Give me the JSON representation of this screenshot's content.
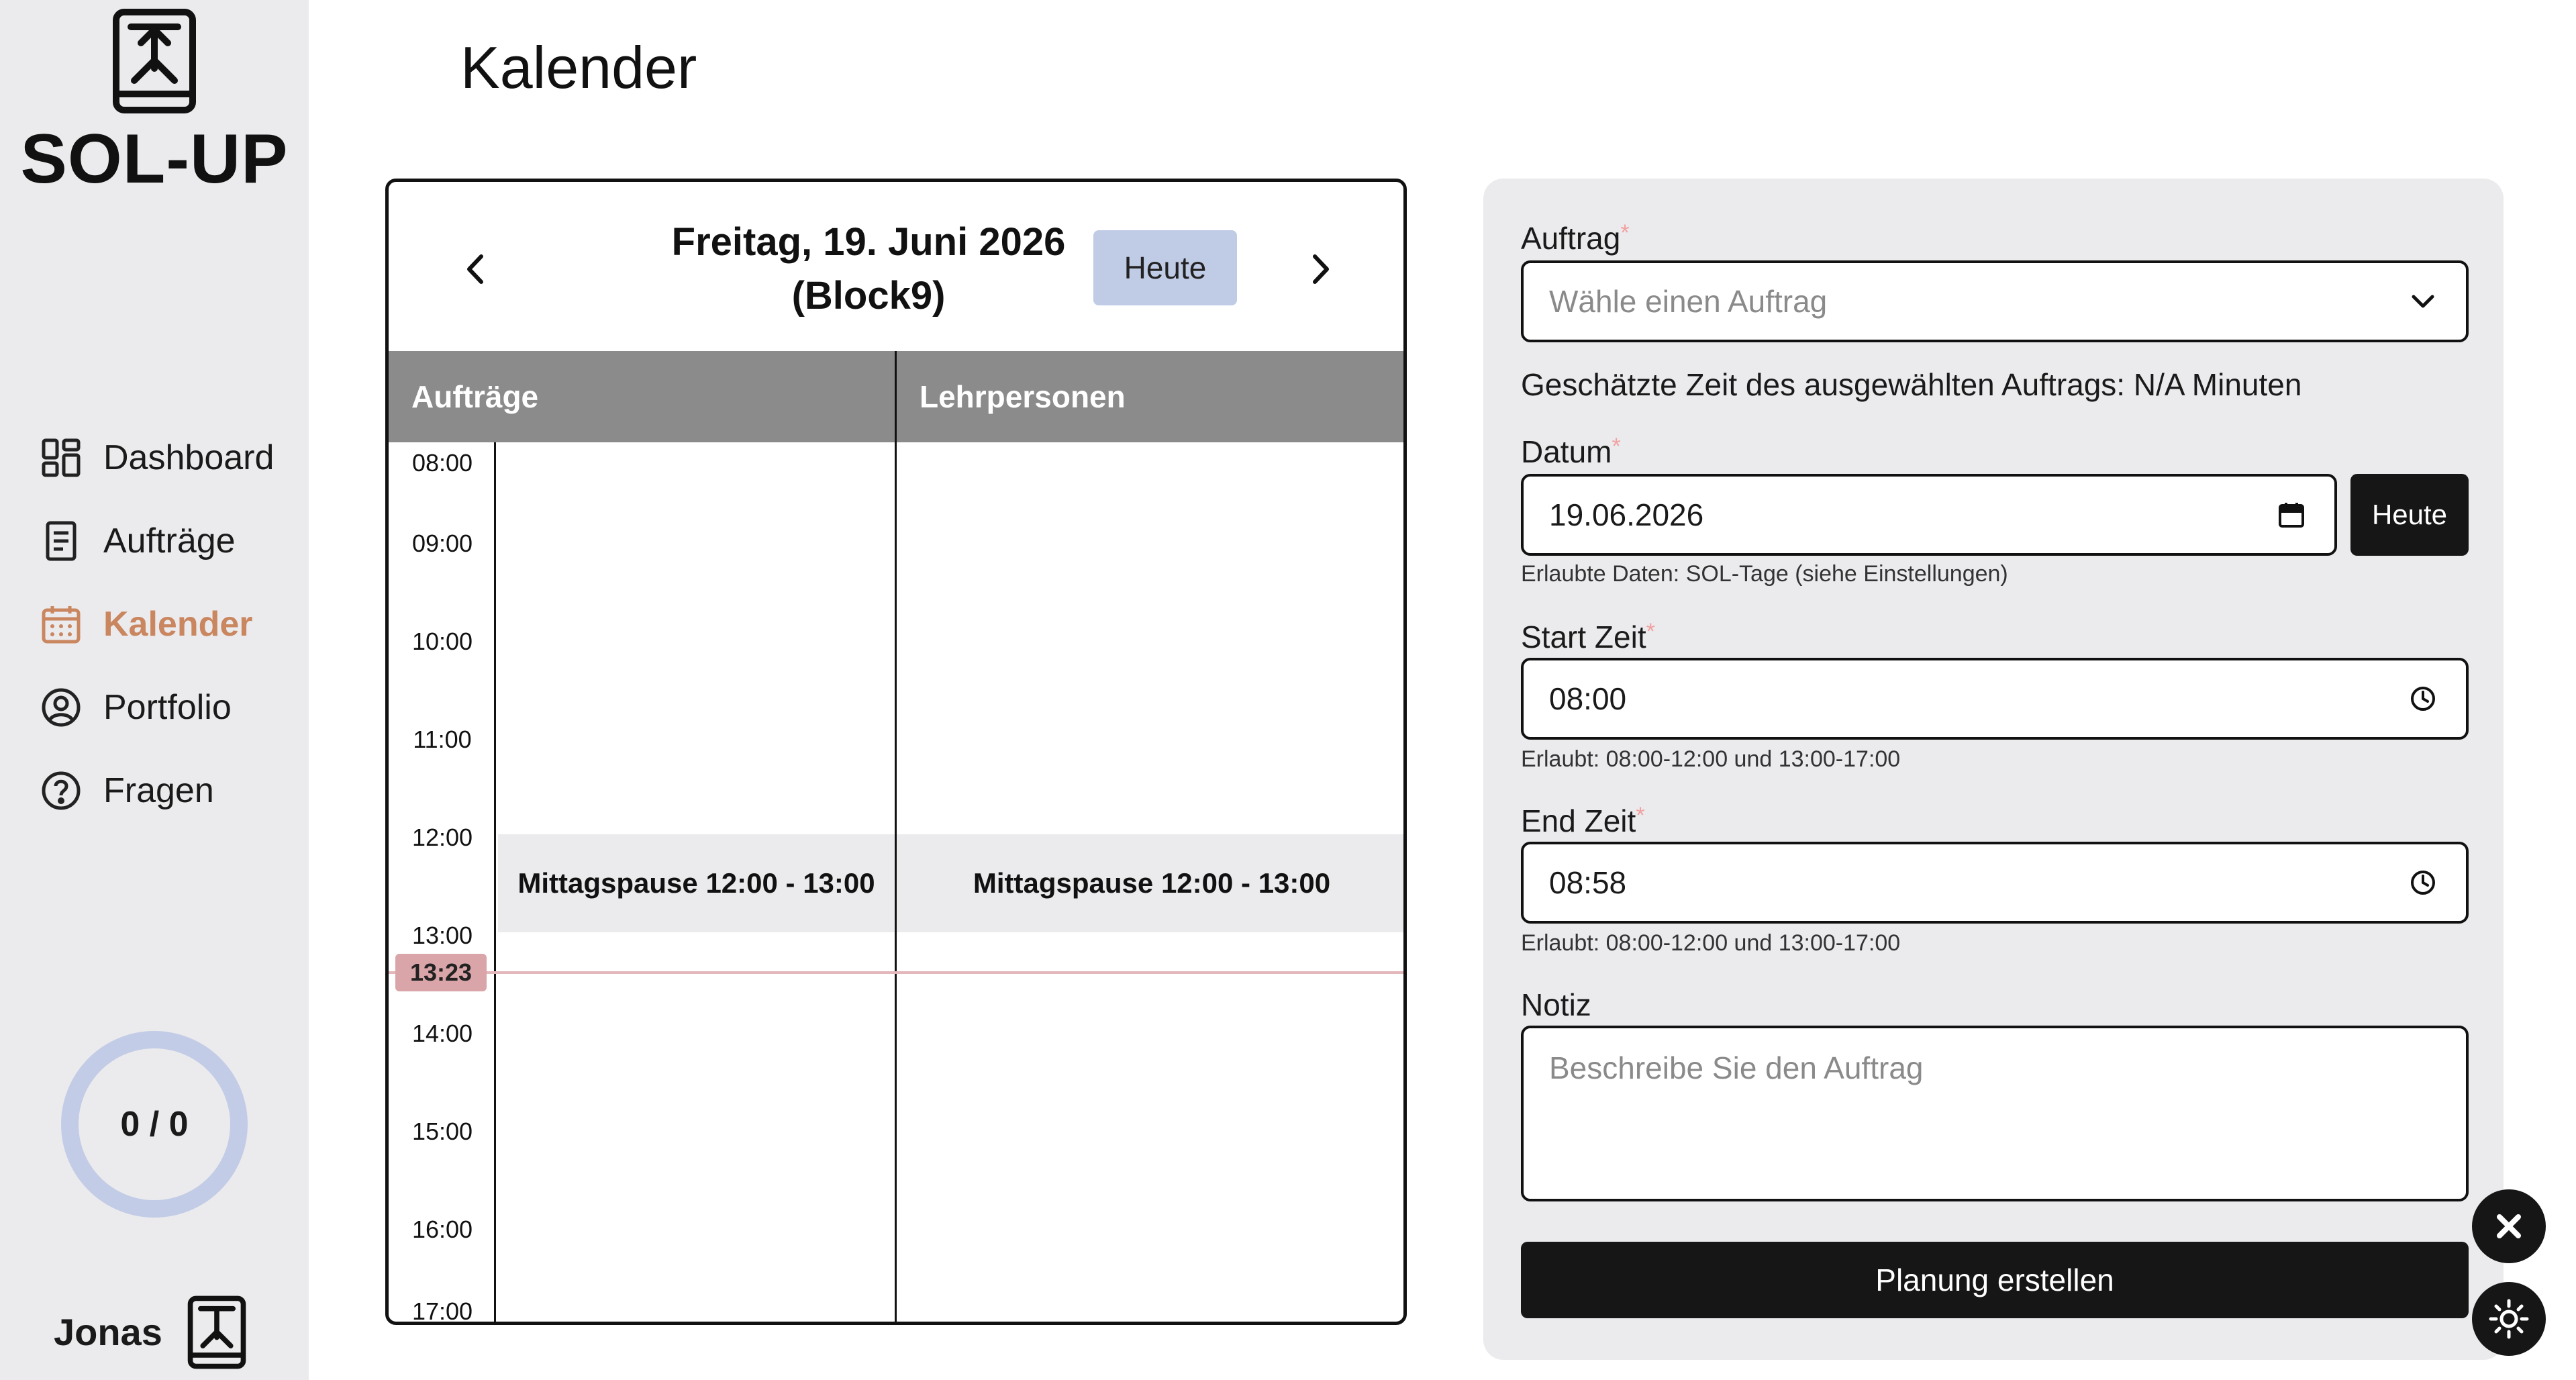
{
  "sidebar": {
    "app_name": "SOL-UP",
    "nav": [
      {
        "label": "Dashboard",
        "icon": "dashboard-icon",
        "active": false
      },
      {
        "label": "Aufträge",
        "icon": "document-icon",
        "active": false
      },
      {
        "label": "Kalender",
        "icon": "calendar-icon",
        "active": true
      },
      {
        "label": "Portfolio",
        "icon": "user-circle-icon",
        "active": false
      },
      {
        "label": "Fragen",
        "icon": "question-icon",
        "active": false
      }
    ],
    "progress_text": "0 / 0",
    "user_name": "Jonas"
  },
  "page": {
    "title": "Kalender"
  },
  "calendar": {
    "date_line1": "Freitag, 19. Juni 2026",
    "date_line2": "(Block9)",
    "today_button": "Heute",
    "columns": [
      "Aufträge",
      "Lehrpersonen"
    ],
    "times": [
      "08:00",
      "09:00",
      "10:00",
      "11:00",
      "12:00",
      "13:00",
      "14:00",
      "15:00",
      "16:00",
      "17:00"
    ],
    "lunch_label": "Mittagspause 12:00 - 13:00",
    "now_time": "13:23"
  },
  "form": {
    "auftrag_label": "Auftrag",
    "auftrag_placeholder": "Wähle einen Auftrag",
    "estimated_time": "Geschätzte Zeit des ausgewählten Auftrags: N/A Minuten",
    "datum_label": "Datum",
    "datum_value": "19.06.2026",
    "datum_today_button": "Heute",
    "datum_hint": "Erlaubte Daten: SOL-Tage (siehe Einstellungen)",
    "start_label": "Start Zeit",
    "start_value": "08:00",
    "start_hint": "Erlaubt: 08:00-12:00 und 13:00-17:00",
    "end_label": "End Zeit",
    "end_value": "08:58",
    "end_hint": "Erlaubt: 08:00-12:00 und 13:00-17:00",
    "notiz_label": "Notiz",
    "notiz_placeholder": "Beschreibe Sie den Auftrag",
    "submit_button": "Planung erstellen",
    "required_marker": "*"
  },
  "colors": {
    "accent": "#c9865f",
    "today_button": "#c0cbe6",
    "header_gray": "#8b8b8b",
    "now_badge": "#d9a5a8",
    "ring": "#c3cce6"
  }
}
